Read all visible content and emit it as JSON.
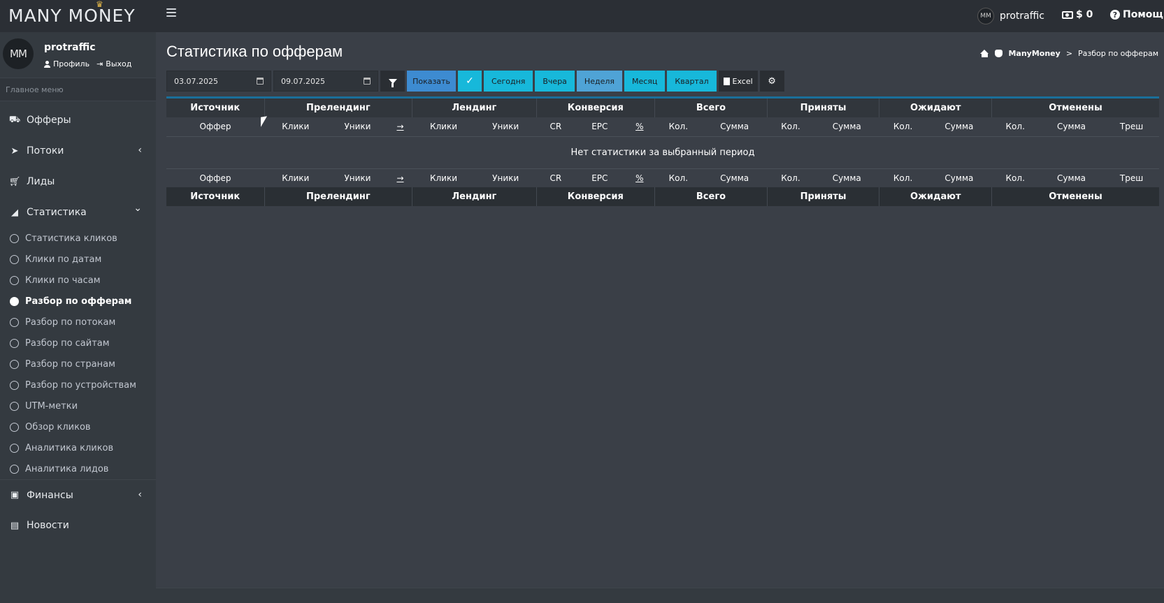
{
  "app": {
    "logo": "MANY MONEY",
    "logo_crown": "♛"
  },
  "navbar": {
    "username": "protraffic",
    "avatar_text": "MM",
    "balance": "$ 0",
    "help": "Помощь"
  },
  "sidebar": {
    "user_name": "protraffic",
    "avatar_text": "MM",
    "profile_link": "Профиль",
    "logout_link": "Выход",
    "menu_header": "Главное меню",
    "items": [
      {
        "label": "Офферы",
        "icon": "basket-icon"
      },
      {
        "label": "Потоки",
        "icon": "paper-plane-icon",
        "arrow": "‹"
      },
      {
        "label": "Лиды",
        "icon": "cart-icon"
      },
      {
        "label": "Статистика",
        "icon": "chart-area-icon",
        "arrow": "⌄"
      },
      {
        "label": "Финансы",
        "icon": "money-bill-icon",
        "arrow": "‹"
      },
      {
        "label": "Новости",
        "icon": "newspaper-icon"
      }
    ],
    "stats_sub": [
      "Статистика кликов",
      "Клики по датам",
      "Клики по часам",
      "Разбор по офферам",
      "Разбор по потокам",
      "Разбор по сайтам",
      "Разбор по странам",
      "Разбор по устройствам",
      "UTM-метки",
      "Обзор кликов",
      "Аналитика кликов",
      "Аналитика лидов"
    ],
    "active_sub": "Разбор по офферам"
  },
  "page": {
    "title": "Статистика по офферам",
    "breadcrumb": [
      "ManyMoney",
      "Разбор по офферам"
    ],
    "breadcrumb_sep": ">"
  },
  "toolbar": {
    "date_from": "03.07.2025",
    "date_to": "09.07.2025",
    "show": "Показать",
    "today": "Сегодня",
    "yesterday": "Вчера",
    "week": "Неделя",
    "month": "Месяц",
    "quarter": "Квартал",
    "excel": "Excel"
  },
  "table": {
    "groups": [
      "Источник",
      "Прелендинг",
      "Лендинг",
      "Конверсия",
      "Всего",
      "Приняты",
      "Ожидают",
      "Отменены"
    ],
    "sub_headers": [
      "Оффер",
      "Клики",
      "Уники",
      "→",
      "Клики",
      "Уники",
      "CR",
      "EPC",
      "%",
      "Кол.",
      "Сумма",
      "Кол.",
      "Сумма",
      "Кол.",
      "Сумма",
      "Кол.",
      "Сумма",
      "Треш"
    ],
    "empty_message": "Нет статистики за выбранный период"
  }
}
